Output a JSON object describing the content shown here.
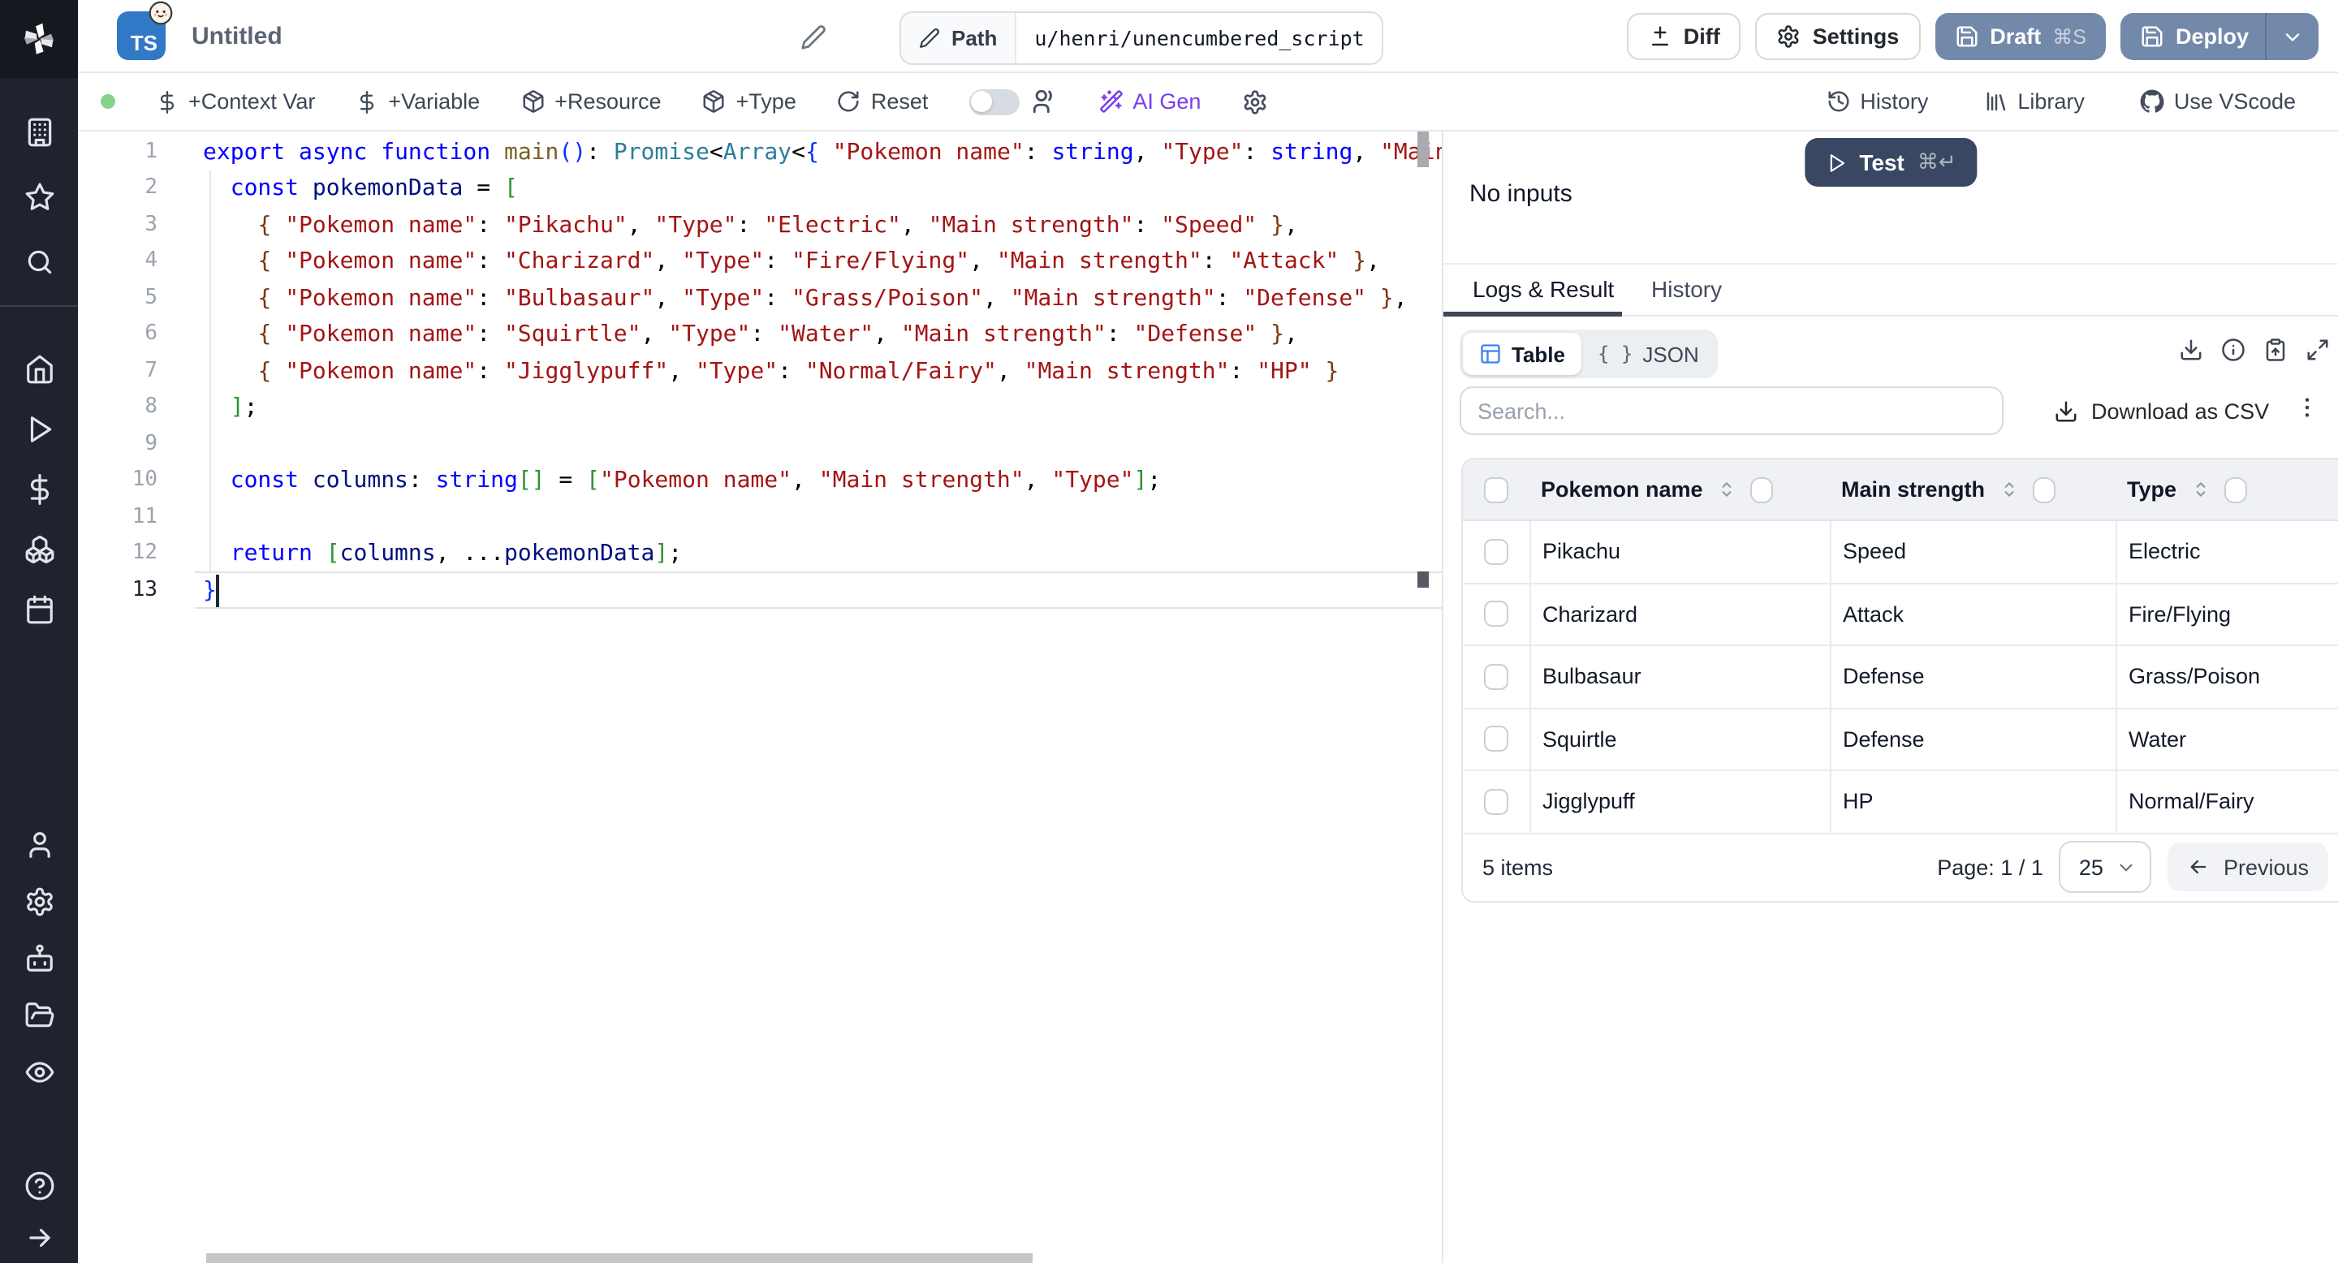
{
  "colors": {
    "primary_button": "#7389aa",
    "test_button": "#394763",
    "ai_gen_accent": "#7c3aed",
    "ts_badge": "#3178c6",
    "table_icon_accent": "#3b82f6",
    "status_dot": "#86d28b",
    "sidebar_bg": "#20232d"
  },
  "sidebar": {
    "groups": [
      {
        "items": [
          [
            "workspace",
            "building"
          ],
          [
            "favorites",
            "star"
          ],
          [
            "search",
            "search"
          ]
        ]
      },
      {
        "items": [
          [
            "home",
            "home"
          ],
          [
            "runs",
            "play"
          ],
          [
            "variables",
            "dollar"
          ],
          [
            "resources",
            "cubes"
          ],
          [
            "schedules",
            "calendar"
          ]
        ]
      },
      {
        "items": [
          [
            "users",
            "user"
          ],
          [
            "settings",
            "gear"
          ],
          [
            "ai",
            "robot"
          ],
          [
            "folders",
            "folder"
          ],
          [
            "audit-logs",
            "eye"
          ]
        ]
      },
      {
        "items": [
          [
            "help",
            "help"
          ],
          [
            "expand-sidebar",
            "arrow-right"
          ]
        ]
      }
    ]
  },
  "topbar": {
    "language": "TS",
    "title": "Untitled",
    "path_label": "Path",
    "path_value": "u/henri/unencumbered_script",
    "diff": "Diff",
    "settings": "Settings",
    "draft": "Draft",
    "draft_shortcut": "⌘S",
    "deploy": "Deploy"
  },
  "toolbar": {
    "context_var": "+Context Var",
    "variable": "+Variable",
    "resource": "+Resource",
    "type": "+Type",
    "reset": "Reset",
    "ai_gen": "AI Gen",
    "history": "History",
    "library": "Library",
    "vscode": "Use VScode"
  },
  "editor": {
    "lines": [
      {
        "n": 1,
        "tokens": [
          [
            "k",
            "export"
          ],
          [
            "d",
            " "
          ],
          [
            "k",
            "async"
          ],
          [
            "d",
            " "
          ],
          [
            "k",
            "function"
          ],
          [
            "d",
            " "
          ],
          [
            "f",
            "main"
          ],
          [
            "b1",
            "()"
          ],
          [
            "d",
            ": "
          ],
          [
            "t",
            "Promise"
          ],
          [
            "d",
            "<"
          ],
          [
            "t",
            "Array"
          ],
          [
            "d",
            "<"
          ],
          [
            "b1",
            "{"
          ],
          [
            "d",
            " "
          ],
          [
            "s",
            "\"Pokemon name\""
          ],
          [
            "d",
            ": "
          ],
          [
            "k",
            "string"
          ],
          [
            "d",
            ", "
          ],
          [
            "s",
            "\"Type\""
          ],
          [
            "d",
            ": "
          ],
          [
            "k",
            "string"
          ],
          [
            "d",
            ", "
          ],
          [
            "s",
            "\"Main"
          ]
        ]
      },
      {
        "n": 2,
        "tokens": [
          [
            "d",
            "  "
          ],
          [
            "k",
            "const"
          ],
          [
            "d",
            " "
          ],
          [
            "v",
            "pokemonData"
          ],
          [
            "d",
            " = "
          ],
          [
            "b2",
            "["
          ]
        ]
      },
      {
        "n": 3,
        "tokens": [
          [
            "d",
            "    "
          ],
          [
            "b3",
            "{"
          ],
          [
            "d",
            " "
          ],
          [
            "s",
            "\"Pokemon name\""
          ],
          [
            "d",
            ": "
          ],
          [
            "s",
            "\"Pikachu\""
          ],
          [
            "d",
            ", "
          ],
          [
            "s",
            "\"Type\""
          ],
          [
            "d",
            ": "
          ],
          [
            "s",
            "\"Electric\""
          ],
          [
            "d",
            ", "
          ],
          [
            "s",
            "\"Main strength\""
          ],
          [
            "d",
            ": "
          ],
          [
            "s",
            "\"Speed\""
          ],
          [
            "d",
            " "
          ],
          [
            "b3",
            "}"
          ],
          [
            "d",
            ","
          ]
        ]
      },
      {
        "n": 4,
        "tokens": [
          [
            "d",
            "    "
          ],
          [
            "b3",
            "{"
          ],
          [
            "d",
            " "
          ],
          [
            "s",
            "\"Pokemon name\""
          ],
          [
            "d",
            ": "
          ],
          [
            "s",
            "\"Charizard\""
          ],
          [
            "d",
            ", "
          ],
          [
            "s",
            "\"Type\""
          ],
          [
            "d",
            ": "
          ],
          [
            "s",
            "\"Fire/Flying\""
          ],
          [
            "d",
            ", "
          ],
          [
            "s",
            "\"Main strength\""
          ],
          [
            "d",
            ": "
          ],
          [
            "s",
            "\"Attack\""
          ],
          [
            "d",
            " "
          ],
          [
            "b3",
            "}"
          ],
          [
            "d",
            ","
          ]
        ]
      },
      {
        "n": 5,
        "tokens": [
          [
            "d",
            "    "
          ],
          [
            "b3",
            "{"
          ],
          [
            "d",
            " "
          ],
          [
            "s",
            "\"Pokemon name\""
          ],
          [
            "d",
            ": "
          ],
          [
            "s",
            "\"Bulbasaur\""
          ],
          [
            "d",
            ", "
          ],
          [
            "s",
            "\"Type\""
          ],
          [
            "d",
            ": "
          ],
          [
            "s",
            "\"Grass/Poison\""
          ],
          [
            "d",
            ", "
          ],
          [
            "s",
            "\"Main strength\""
          ],
          [
            "d",
            ": "
          ],
          [
            "s",
            "\"Defense\""
          ],
          [
            "d",
            " "
          ],
          [
            "b3",
            "}"
          ],
          [
            "d",
            ","
          ]
        ]
      },
      {
        "n": 6,
        "tokens": [
          [
            "d",
            "    "
          ],
          [
            "b3",
            "{"
          ],
          [
            "d",
            " "
          ],
          [
            "s",
            "\"Pokemon name\""
          ],
          [
            "d",
            ": "
          ],
          [
            "s",
            "\"Squirtle\""
          ],
          [
            "d",
            ", "
          ],
          [
            "s",
            "\"Type\""
          ],
          [
            "d",
            ": "
          ],
          [
            "s",
            "\"Water\""
          ],
          [
            "d",
            ", "
          ],
          [
            "s",
            "\"Main strength\""
          ],
          [
            "d",
            ": "
          ],
          [
            "s",
            "\"Defense\""
          ],
          [
            "d",
            " "
          ],
          [
            "b3",
            "}"
          ],
          [
            "d",
            ","
          ]
        ]
      },
      {
        "n": 7,
        "tokens": [
          [
            "d",
            "    "
          ],
          [
            "b3",
            "{"
          ],
          [
            "d",
            " "
          ],
          [
            "s",
            "\"Pokemon name\""
          ],
          [
            "d",
            ": "
          ],
          [
            "s",
            "\"Jigglypuff\""
          ],
          [
            "d",
            ", "
          ],
          [
            "s",
            "\"Type\""
          ],
          [
            "d",
            ": "
          ],
          [
            "s",
            "\"Normal/Fairy\""
          ],
          [
            "d",
            ", "
          ],
          [
            "s",
            "\"Main strength\""
          ],
          [
            "d",
            ": "
          ],
          [
            "s",
            "\"HP\""
          ],
          [
            "d",
            " "
          ],
          [
            "b3",
            "}"
          ]
        ]
      },
      {
        "n": 8,
        "tokens": [
          [
            "d",
            "  "
          ],
          [
            "b2",
            "]"
          ],
          [
            "d",
            ";"
          ]
        ]
      },
      {
        "n": 9,
        "tokens": []
      },
      {
        "n": 10,
        "tokens": [
          [
            "d",
            "  "
          ],
          [
            "k",
            "const"
          ],
          [
            "d",
            " "
          ],
          [
            "v",
            "columns"
          ],
          [
            "d",
            ": "
          ],
          [
            "k",
            "string"
          ],
          [
            "b2",
            "[]"
          ],
          [
            "d",
            " = "
          ],
          [
            "b2",
            "["
          ],
          [
            "s",
            "\"Pokemon name\""
          ],
          [
            "d",
            ", "
          ],
          [
            "s",
            "\"Main strength\""
          ],
          [
            "d",
            ", "
          ],
          [
            "s",
            "\"Type\""
          ],
          [
            "b2",
            "]"
          ],
          [
            "d",
            ";"
          ]
        ]
      },
      {
        "n": 11,
        "tokens": []
      },
      {
        "n": 12,
        "tokens": [
          [
            "d",
            "  "
          ],
          [
            "k",
            "return"
          ],
          [
            "d",
            " "
          ],
          [
            "b2",
            "["
          ],
          [
            "v",
            "columns"
          ],
          [
            "d",
            ", ..."
          ],
          [
            "v",
            "pokemonData"
          ],
          [
            "b2",
            "]"
          ],
          [
            "d",
            ";"
          ]
        ]
      },
      {
        "n": 13,
        "tokens": [
          [
            "b1",
            "}"
          ]
        ],
        "active": true
      }
    ]
  },
  "panel": {
    "test": "Test",
    "test_shortcut": "⌘↵",
    "no_inputs": "No inputs",
    "tabs": [
      {
        "label": "Logs & Result",
        "active": true
      },
      {
        "label": "History",
        "active": false
      }
    ],
    "view_table": "Table",
    "view_json": "JSON",
    "search_placeholder": "Search...",
    "download_csv": "Download as CSV",
    "table": {
      "columns": [
        "Pokemon name",
        "Main strength",
        "Type"
      ],
      "rows": [
        [
          "Pikachu",
          "Speed",
          "Electric"
        ],
        [
          "Charizard",
          "Attack",
          "Fire/Flying"
        ],
        [
          "Bulbasaur",
          "Defense",
          "Grass/Poison"
        ],
        [
          "Squirtle",
          "Defense",
          "Water"
        ],
        [
          "Jigglypuff",
          "HP",
          "Normal/Fairy"
        ]
      ]
    },
    "footer": {
      "items": "5 items",
      "page": "Page: 1 / 1",
      "page_size": "25",
      "previous": "Previous"
    }
  }
}
